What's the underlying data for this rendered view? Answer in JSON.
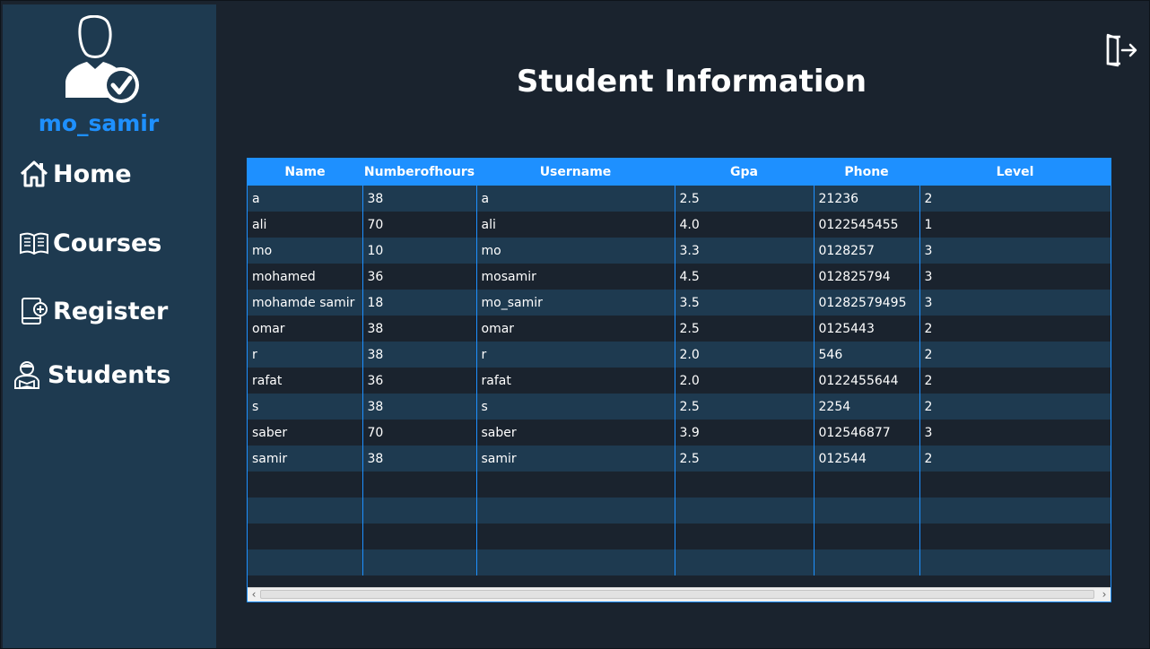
{
  "user": {
    "name": "mo_samir"
  },
  "nav": [
    {
      "label": "Home",
      "icon": "home-icon"
    },
    {
      "label": "Courses",
      "icon": "book-icon"
    },
    {
      "label": "Register",
      "icon": "register-icon"
    },
    {
      "label": "Students",
      "icon": "student-icon"
    }
  ],
  "page": {
    "title": "Student Information",
    "exit_icon": "logout-icon"
  },
  "colors": {
    "accent": "#1e90ff",
    "sidebar": "#1e3a50",
    "background": "#1a232e"
  },
  "table": {
    "columns": [
      "Name",
      "Numberofhours",
      "Username",
      "Gpa",
      "Phone",
      "Level"
    ],
    "rows": [
      [
        "a",
        "38",
        "a",
        "2.5",
        "21236",
        "2"
      ],
      [
        "ali",
        "70",
        "ali",
        "4.0",
        "0122545455",
        "1"
      ],
      [
        "mo",
        "10",
        "mo",
        "3.3",
        "0128257",
        "3"
      ],
      [
        "mohamed",
        "36",
        "mosamir",
        "4.5",
        "012825794",
        "3"
      ],
      [
        "mohamde samir",
        "18",
        "mo_samir",
        "3.5",
        "01282579495",
        "3"
      ],
      [
        "omar",
        "38",
        "omar",
        "2.5",
        "0125443",
        "2"
      ],
      [
        "r",
        "38",
        "r",
        "2.0",
        "546",
        "2"
      ],
      [
        "rafat",
        "36",
        "rafat",
        "2.0",
        "0122455644",
        "2"
      ],
      [
        "s",
        "38",
        "s",
        "2.5",
        "2254",
        "2"
      ],
      [
        "saber",
        "70",
        "saber",
        "3.9",
        "012546877",
        "3"
      ],
      [
        "samir",
        "38",
        "samir",
        "2.5",
        "012544",
        "2"
      ]
    ]
  }
}
